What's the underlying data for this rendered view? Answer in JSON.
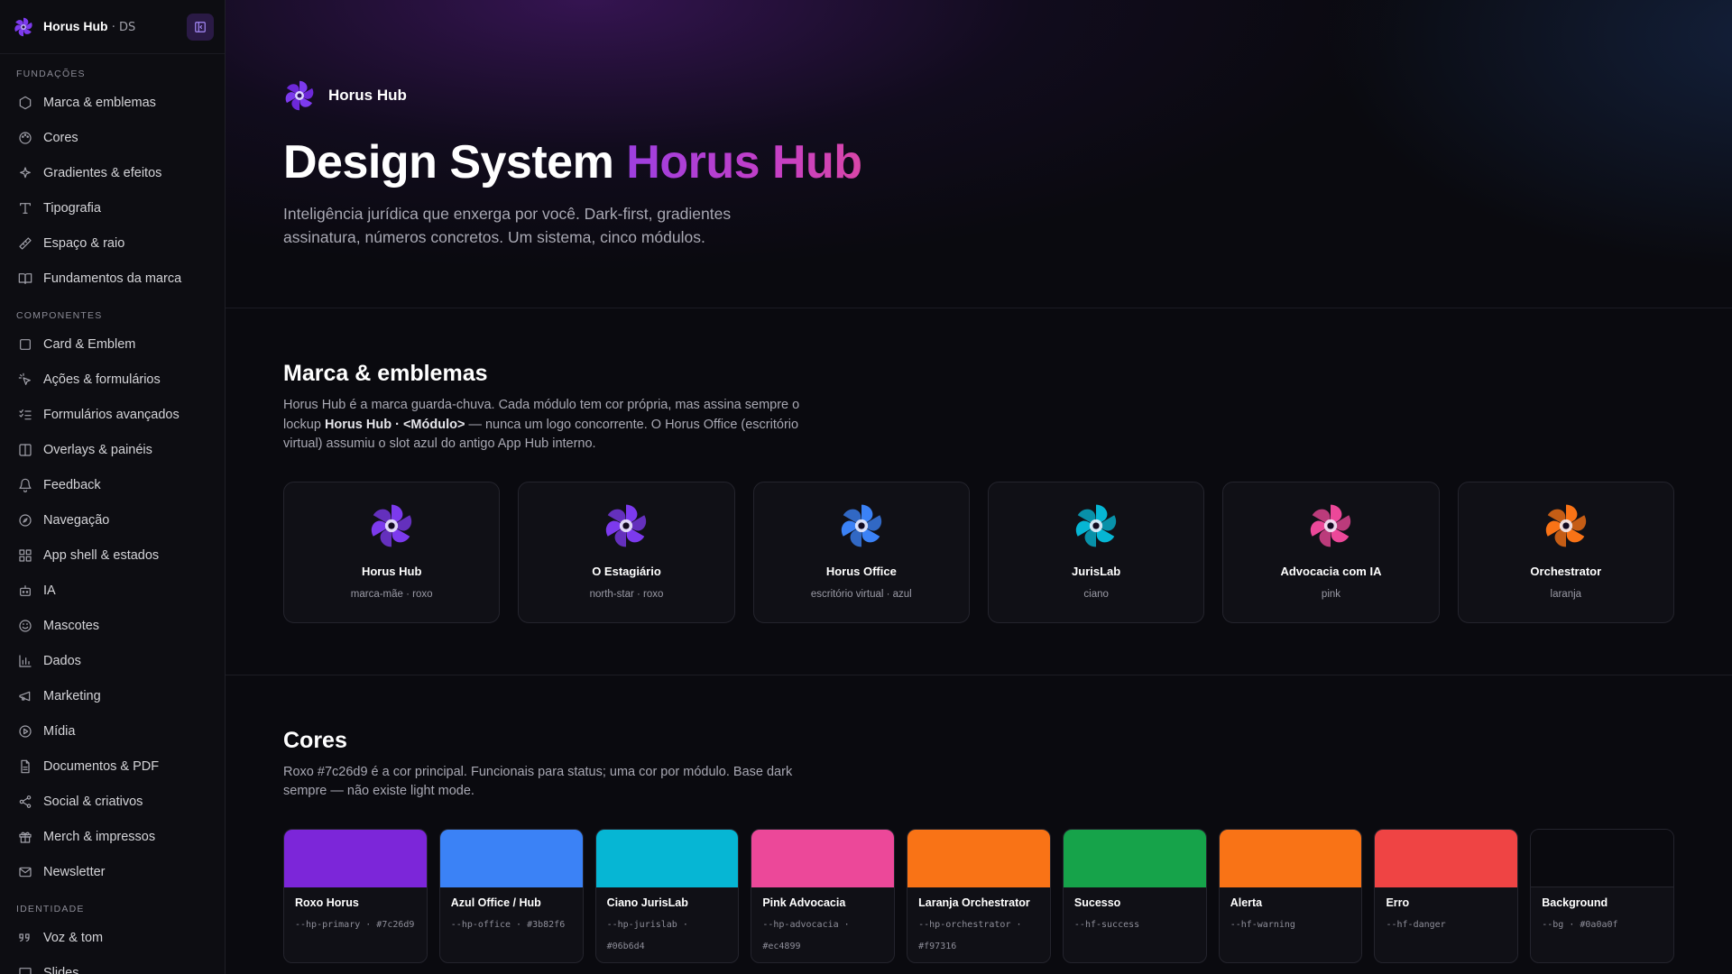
{
  "sidebar": {
    "title": "Horus Hub",
    "title_suffix": " · DS",
    "sections": [
      {
        "label": "Fundações",
        "items": [
          {
            "label": "Marca & emblemas",
            "icon": "hexagon-icon"
          },
          {
            "label": "Cores",
            "icon": "palette-icon"
          },
          {
            "label": "Gradientes & efeitos",
            "icon": "sparkles-icon"
          },
          {
            "label": "Tipografia",
            "icon": "type-icon"
          },
          {
            "label": "Espaço & raio",
            "icon": "ruler-icon"
          },
          {
            "label": "Fundamentos da marca",
            "icon": "book-icon"
          }
        ]
      },
      {
        "label": "Componentes",
        "items": [
          {
            "label": "Card & Emblem",
            "icon": "square-icon"
          },
          {
            "label": "Ações & formulários",
            "icon": "pointer-icon"
          },
          {
            "label": "Formulários avançados",
            "icon": "list-checks-icon"
          },
          {
            "label": "Overlays & painéis",
            "icon": "panel-icon"
          },
          {
            "label": "Feedback",
            "icon": "bell-icon"
          },
          {
            "label": "Navegação",
            "icon": "compass-icon"
          },
          {
            "label": "App shell & estados",
            "icon": "layout-grid-icon"
          },
          {
            "label": "IA",
            "icon": "bot-icon"
          },
          {
            "label": "Mascotes",
            "icon": "smile-icon"
          },
          {
            "label": "Dados",
            "icon": "bar-chart-icon"
          },
          {
            "label": "Marketing",
            "icon": "megaphone-icon"
          },
          {
            "label": "Mídia",
            "icon": "play-circle-icon"
          },
          {
            "label": "Documentos & PDF",
            "icon": "file-text-icon"
          },
          {
            "label": "Social & criativos",
            "icon": "share-icon"
          },
          {
            "label": "Merch & impressos",
            "icon": "gift-icon"
          },
          {
            "label": "Newsletter",
            "icon": "mail-icon"
          }
        ]
      },
      {
        "label": "Identidade",
        "items": [
          {
            "label": "Voz & tom",
            "icon": "quote-icon"
          },
          {
            "label": "Slides",
            "icon": "presentation-icon"
          }
        ]
      }
    ]
  },
  "hero": {
    "brand": "Horus Hub",
    "title_main": "Design System ",
    "title_accent": "Horus Hub",
    "description": "Inteligência jurídica que enxerga por você. Dark-first, gradientes assinatura, números concretos. Um sistema, cinco módulos."
  },
  "brand_section": {
    "title": "Marca & emblemas",
    "desc_part1": "Horus Hub é a marca guarda-chuva. Cada módulo tem cor própria, mas assina sempre o lockup ",
    "desc_bold": "Horus Hub · <Módulo>",
    "desc_part2": " — nunca um logo concorrente. O Horus Office (escritório virtual) assumiu o slot azul do antigo App Hub interno.",
    "cards": [
      {
        "name": "Horus Hub",
        "meta": "marca-mãe · roxo",
        "color": "#7c3aed"
      },
      {
        "name": "O Estagiário",
        "meta": "north-star · roxo",
        "color": "#7c3aed"
      },
      {
        "name": "Horus Office",
        "meta": "escritório virtual · azul",
        "color": "#3b82f6"
      },
      {
        "name": "JurisLab",
        "meta": "ciano",
        "color": "#06b6d4"
      },
      {
        "name": "Advocacia com IA",
        "meta": "pink",
        "color": "#ec4899"
      },
      {
        "name": "Orchestrator",
        "meta": "laranja",
        "color": "#f97316"
      }
    ]
  },
  "colors_section": {
    "title": "Cores",
    "description": "Roxo #7c26d9 é a cor principal. Funcionais para status; uma cor por módulo. Base dark sempre — não existe light mode.",
    "swatches": [
      {
        "name": "Roxo Horus",
        "token": "--hp-primary · #7c26d9",
        "color": "#7c26d9"
      },
      {
        "name": "Azul Office / Hub",
        "token": "--hp-office · #3b82f6",
        "color": "#3b82f6"
      },
      {
        "name": "Ciano JurisLab",
        "token": "--hp-jurislab · #06b6d4",
        "color": "#06b6d4"
      },
      {
        "name": "Pink Advocacia",
        "token": "--hp-advocacia · #ec4899",
        "color": "#ec4899"
      },
      {
        "name": "Laranja Orchestrator",
        "token": "--hp-orchestrator · #f97316",
        "color": "#f97316"
      },
      {
        "name": "Sucesso",
        "token": "--hf-success",
        "color": "#16a34a"
      },
      {
        "name": "Alerta",
        "token": "--hf-warning",
        "color": "#f97316"
      },
      {
        "name": "Erro",
        "token": "--hf-danger",
        "color": "#ef4444"
      },
      {
        "name": "Background",
        "token": "--bg · #0a0a0f",
        "color": "#0a0a0f"
      }
    ]
  }
}
